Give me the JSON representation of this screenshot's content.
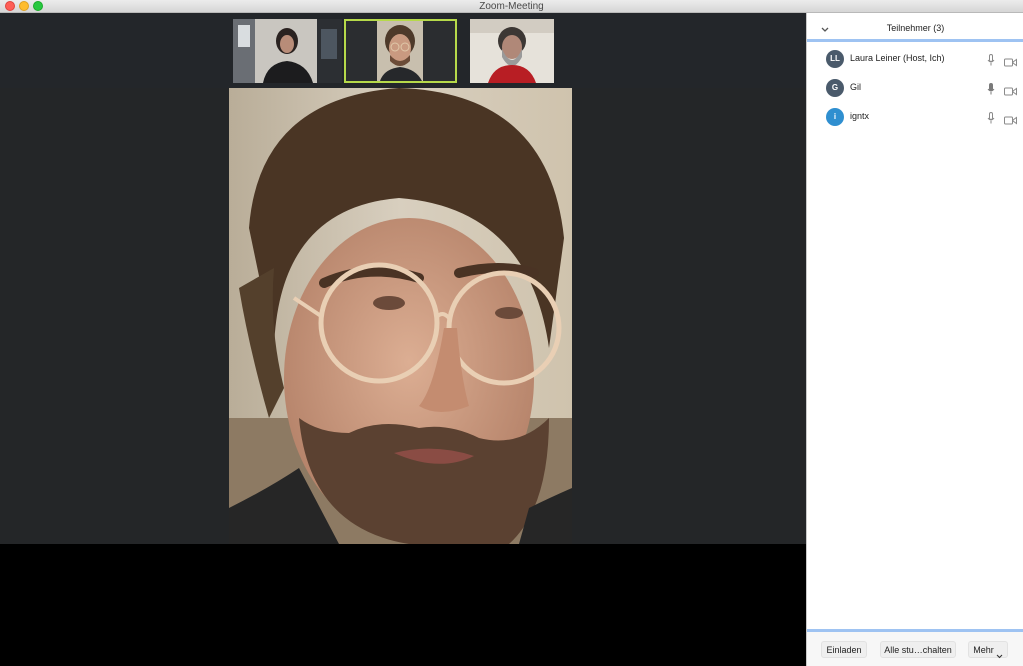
{
  "window": {
    "title": "Zoom-Meeting"
  },
  "colors": {
    "active_speaker_border": "#b6d94a",
    "panel_accent": "#9ec3f2",
    "stage_background": "#242628"
  },
  "panel": {
    "title": "Teilnehmer (3)",
    "collapse_icon": "chevron-down-icon",
    "participants": [
      {
        "initials": "LL",
        "name": "Laura Leiner (Host, Ich)",
        "avatar_color": "#4a5a6b"
      },
      {
        "initials": "G",
        "name": "Gil",
        "avatar_color": "#4a5a6b"
      },
      {
        "initials": "i",
        "name": "igntx",
        "avatar_color": "#2f8fd0"
      }
    ],
    "footer": {
      "invite_label": "Einladen",
      "mute_all_label": "Alle stu…chalten",
      "more_label": "Mehr"
    }
  }
}
